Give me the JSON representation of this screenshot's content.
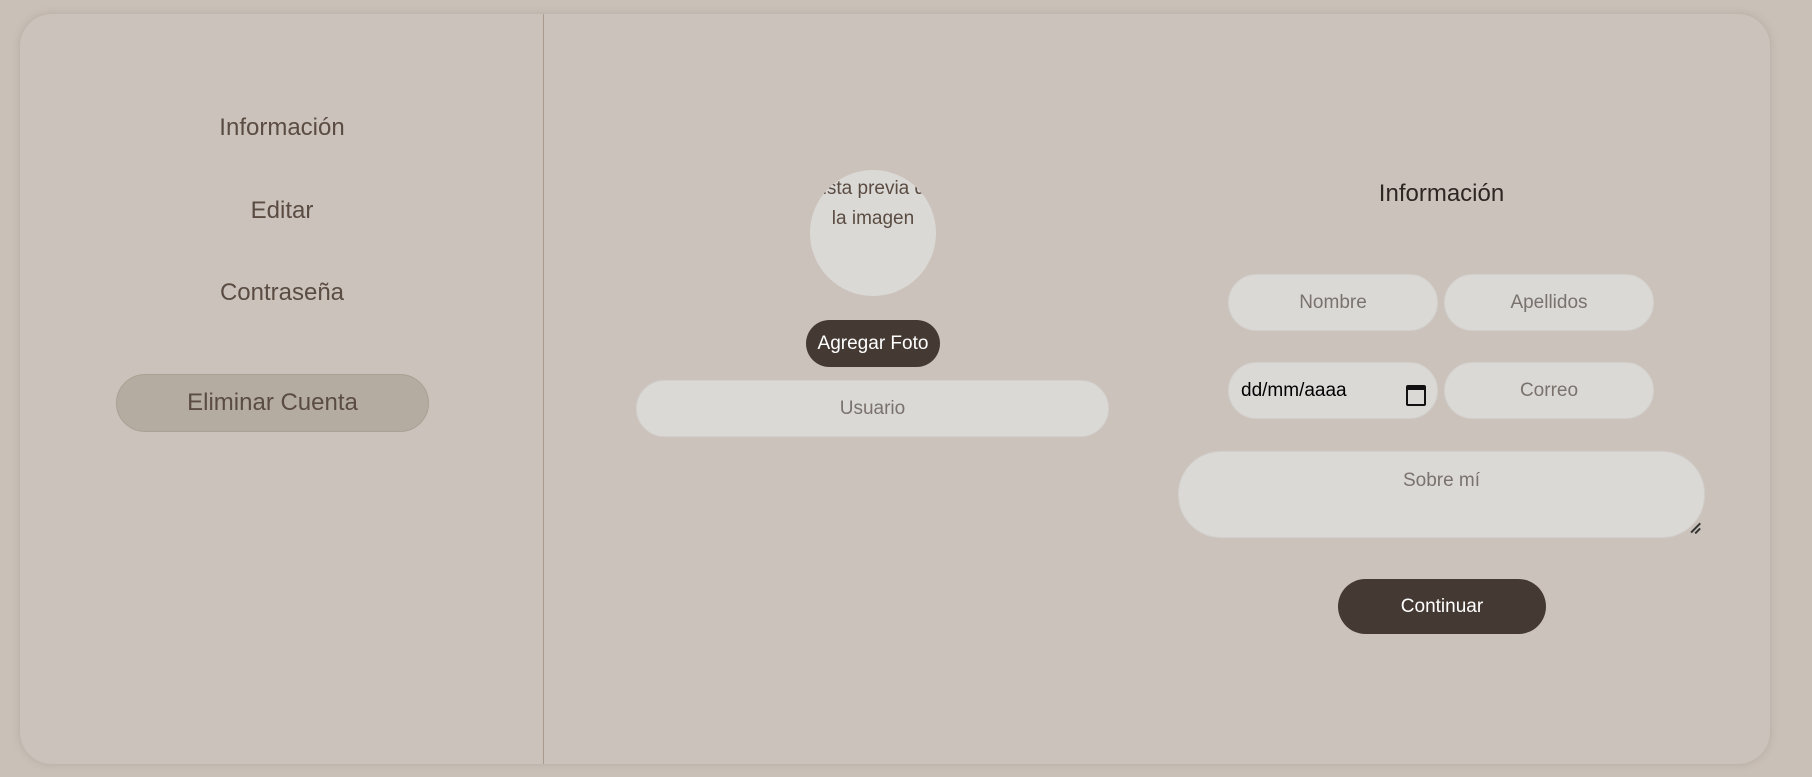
{
  "sidebar": {
    "items": [
      {
        "label": "Información"
      },
      {
        "label": "Editar"
      },
      {
        "label": "Contraseña"
      }
    ],
    "delete_label": "Eliminar Cuenta"
  },
  "profile": {
    "avatar_alt_text": "Vista previa de la imagen",
    "add_photo_label": "Agregar Foto",
    "username_placeholder": "Usuario"
  },
  "form": {
    "title": "Información",
    "first_name_placeholder": "Nombre",
    "last_name_placeholder": "Apellidos",
    "date_placeholder": "dd/mm/aaaa",
    "email_placeholder": "Correo",
    "about_placeholder": "Sobre mí",
    "continue_label": "Continuar"
  },
  "colors": {
    "background": "#c9c0b8",
    "card": "#cbc2bb",
    "field": "#dbd9d6",
    "primary_button": "#453a33",
    "delete_button": "#b5aca1",
    "text": "#5a4c42"
  }
}
